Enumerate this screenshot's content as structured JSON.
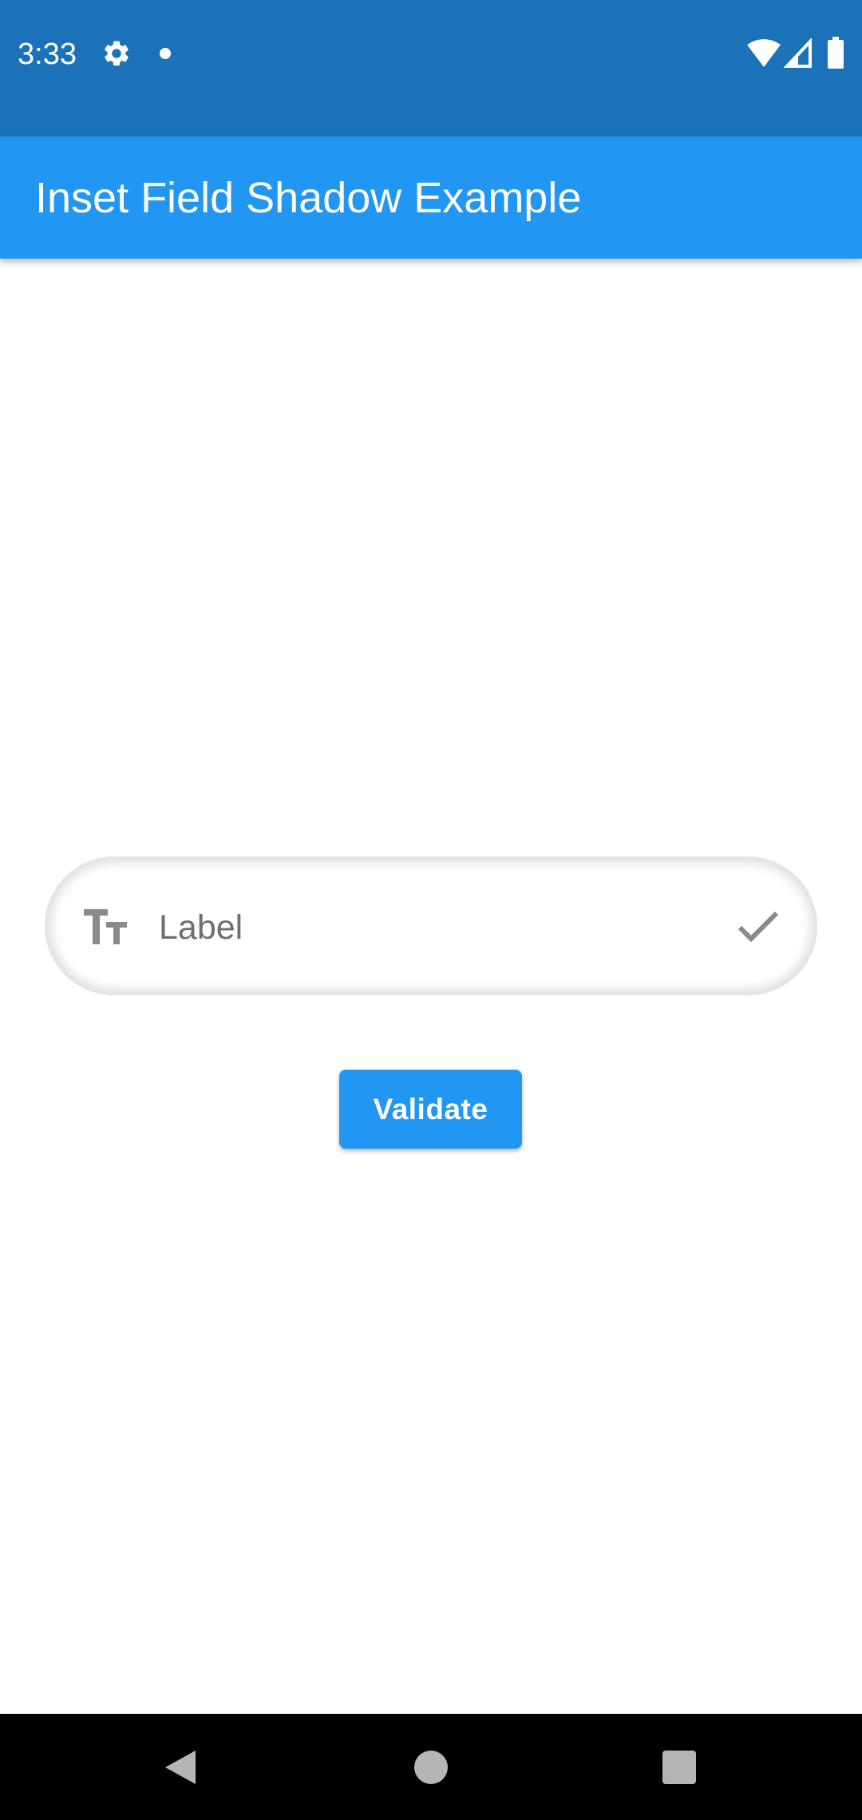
{
  "status_bar": {
    "time": "3:33",
    "icons": [
      "gear-icon",
      "notification-dot-icon",
      "wifi-icon",
      "signal-icon",
      "battery-icon"
    ]
  },
  "app_bar": {
    "title": "Inset Field Shadow Example"
  },
  "form": {
    "field": {
      "leading_icon": "text-size-icon",
      "label": "Label",
      "trailing_icon": "check-icon"
    },
    "validate_label": "Validate"
  },
  "nav_bar": {
    "icons": [
      "back-icon",
      "home-icon",
      "recents-icon"
    ]
  },
  "colors": {
    "status_bar": "#1b72b8",
    "app_bar": "#2196f3",
    "button": "#2196f3",
    "nav_bar": "#000000",
    "field_border": "#e4e4e4",
    "icon_gray": "#8a8a8a"
  }
}
